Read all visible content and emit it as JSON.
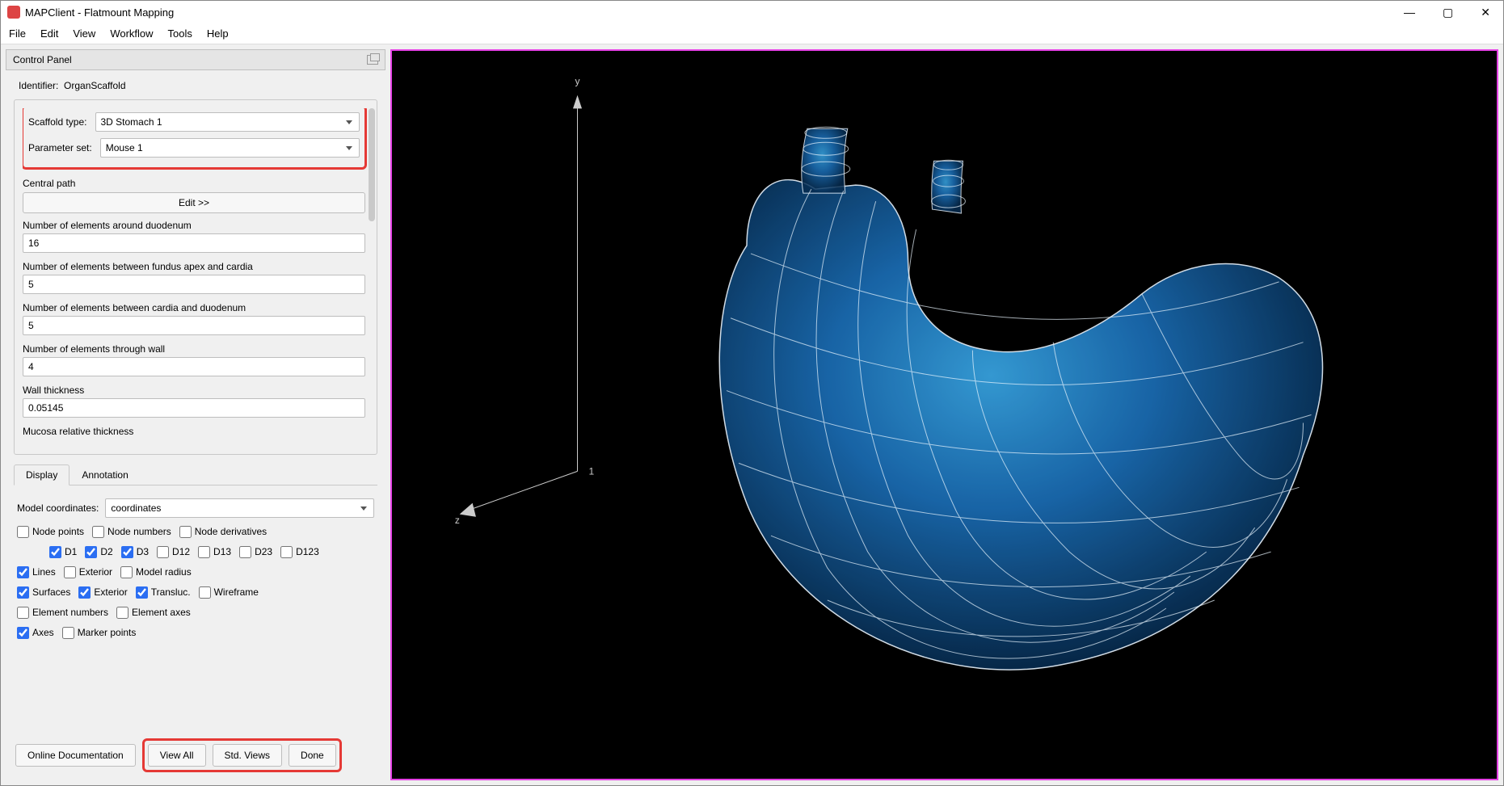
{
  "window": {
    "title": "MAPClient - Flatmount Mapping",
    "controls": {
      "min": "—",
      "max": "▢",
      "close": "✕"
    }
  },
  "menu": {
    "items": [
      "File",
      "Edit",
      "View",
      "Workflow",
      "Tools",
      "Help"
    ]
  },
  "panel": {
    "title": "Control Panel",
    "identifier_label": "Identifier:",
    "identifier_value": "OrganScaffold",
    "scaffold_type_label": "Scaffold type:",
    "scaffold_type_value": "3D Stomach 1",
    "parameter_set_label": "Parameter set:",
    "parameter_set_value": "Mouse 1",
    "central_path_label": "Central path",
    "edit_btn": "Edit >>",
    "fields": [
      {
        "label": "Number of elements around duodenum",
        "value": "16"
      },
      {
        "label": "Number of elements between fundus apex and cardia",
        "value": "5"
      },
      {
        "label": "Number of elements between cardia and duodenum",
        "value": "5"
      },
      {
        "label": "Number of elements through wall",
        "value": "4"
      },
      {
        "label": "Wall thickness",
        "value": "0.05145"
      },
      {
        "label": "Mucosa relative thickness",
        "value": ""
      }
    ],
    "tabs": {
      "display": "Display",
      "annotation": "Annotation"
    },
    "model_coords_label": "Model coordinates:",
    "model_coords_value": "coordinates",
    "checks": {
      "node_points": "Node points",
      "node_numbers": "Node numbers",
      "node_derivatives": "Node derivatives",
      "d1": "D1",
      "d2": "D2",
      "d3": "D3",
      "d12": "D12",
      "d13": "D13",
      "d23": "D23",
      "d123": "D123",
      "lines": "Lines",
      "exterior": "Exterior",
      "model_radius": "Model radius",
      "surfaces": "Surfaces",
      "exterior2": "Exterior",
      "transluc": "Transluc.",
      "wireframe": "Wireframe",
      "element_numbers": "Element numbers",
      "element_axes": "Element axes",
      "axes": "Axes",
      "marker_points": "Marker points"
    },
    "buttons": {
      "docs": "Online Documentation",
      "view_all": "View All",
      "std_views": "Std. Views",
      "done": "Done"
    }
  },
  "viewport": {
    "axis_y": "y",
    "axis_z": "z",
    "axis_scale": "1"
  }
}
